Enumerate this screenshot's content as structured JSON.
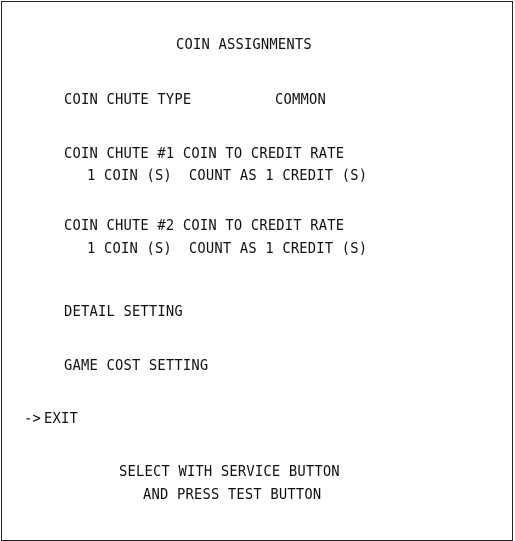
{
  "screen": {
    "title": "COIN ASSIGNMENTS",
    "coin_chute_type": {
      "label": "COIN CHUTE TYPE",
      "value": "COMMON"
    },
    "chute1": {
      "label": "COIN CHUTE #1 COIN TO CREDIT RATE",
      "rate": "1 COIN (S)  COUNT AS 1 CREDIT (S)"
    },
    "chute2": {
      "label": "COIN CHUTE #2 COIN TO CREDIT RATE",
      "rate": "1 COIN (S)  COUNT AS 1 CREDIT (S)"
    },
    "detail_setting": "DETAIL SETTING",
    "game_cost_setting": "GAME COST SETTING",
    "cursor": "->",
    "exit": "EXIT",
    "instructions": {
      "line1": "SELECT WITH SERVICE BUTTON",
      "line2": "AND PRESS TEST BUTTON"
    },
    "colors": {
      "background": "#ffffff",
      "text": "#111111",
      "border": "#222222"
    }
  }
}
